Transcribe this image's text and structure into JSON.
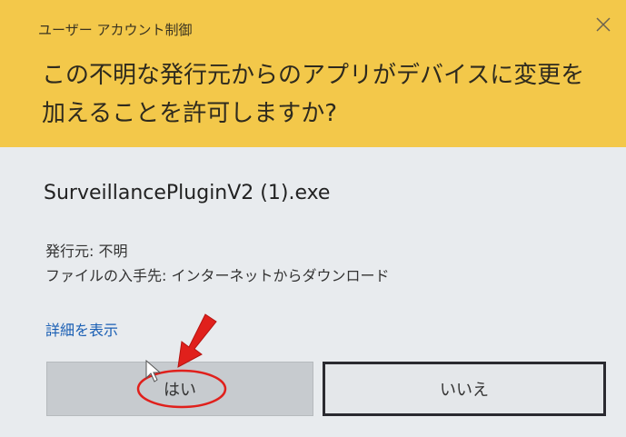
{
  "dialog": {
    "title": "ユーザー アカウント制御",
    "question": "この不明な発行元からのアプリがデバイスに変更を加えることを許可しますか?",
    "header_color": "#f3c84a"
  },
  "app": {
    "filename": "SurveillancePluginV2 (1).exe",
    "publisher": "発行元: 不明",
    "origin": "ファイルの入手先: インターネットからダウンロード"
  },
  "links": {
    "details": "詳細を表示"
  },
  "buttons": {
    "yes": "はい",
    "no": "いいえ"
  },
  "annotation": {
    "arrow_color": "#e0201c",
    "circle_color": "#e0201c"
  },
  "icons": {
    "close": "close-icon",
    "cursor": "mouse-pointer-icon",
    "arrow": "red-arrow-icon"
  }
}
